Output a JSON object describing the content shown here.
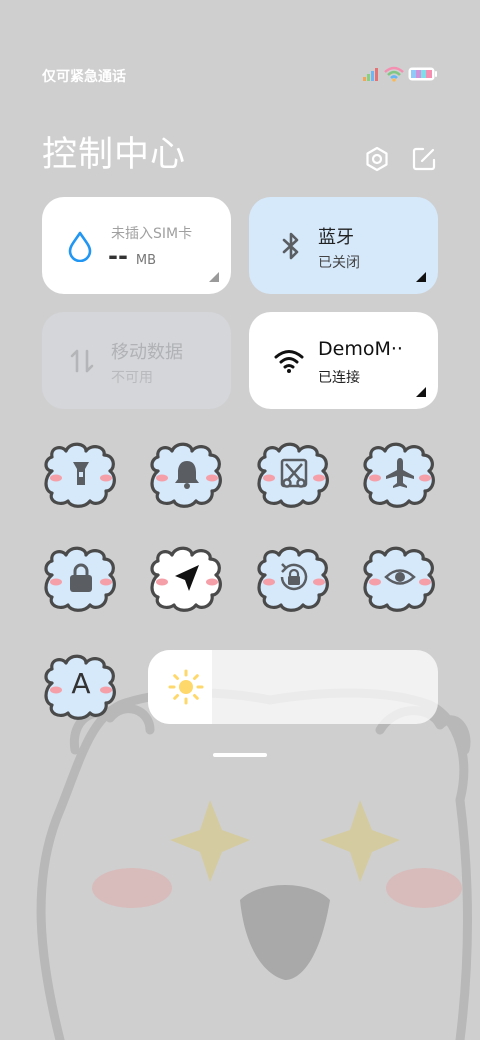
{
  "status_bar": {
    "text": "仅可紧急通话",
    "icons": [
      "signal-icon",
      "wifi-icon",
      "battery-icon"
    ]
  },
  "header": {
    "title": "控制中心",
    "settings_icon": "gear-icon",
    "edit_icon": "edit-icon"
  },
  "tiles": {
    "sim": {
      "label": "未插入SIM卡",
      "value": "--",
      "unit": "MB",
      "icon": "water-drop-icon"
    },
    "bluetooth": {
      "label": "蓝牙",
      "status": "已关闭",
      "icon": "bluetooth-icon"
    },
    "mobile_data": {
      "label": "移动数据",
      "status": "不可用",
      "icon": "data-arrows-icon"
    },
    "wifi": {
      "label": "DemoM··",
      "status": "已连接",
      "icon": "wifi-icon"
    }
  },
  "toggles": [
    {
      "name": "flashlight",
      "icon": "flashlight-icon",
      "active": false
    },
    {
      "name": "ringer",
      "icon": "bell-icon",
      "active": false
    },
    {
      "name": "screenshot",
      "icon": "scissors-icon",
      "active": false
    },
    {
      "name": "airplane-mode",
      "icon": "airplane-icon",
      "active": false
    },
    {
      "name": "lock-screen",
      "icon": "lock-icon",
      "active": false
    },
    {
      "name": "location",
      "icon": "location-arrow-icon",
      "active": true
    },
    {
      "name": "auto-rotate",
      "icon": "rotate-lock-icon",
      "active": false
    },
    {
      "name": "reading-mode",
      "icon": "eye-icon",
      "active": false
    },
    {
      "name": "font-size",
      "icon": "letter-a-icon",
      "active": false,
      "letter": "A"
    }
  ],
  "brightness": {
    "level": 0.22,
    "icon": "sun-icon"
  },
  "colors": {
    "tile_blue": "#d6e9fb",
    "cloud_fill": "#d6e9fb",
    "cloud_outline": "#4a4a4a",
    "blush": "#f5a0a8",
    "icon_dark": "#5a5e63",
    "accent_blue": "#2196f3"
  }
}
